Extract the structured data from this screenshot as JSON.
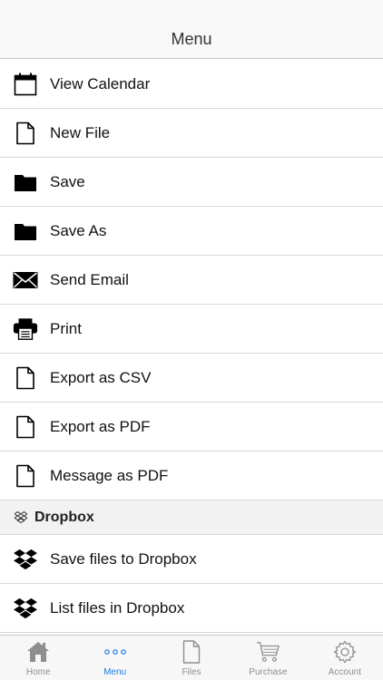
{
  "navbar": {
    "title": "Menu"
  },
  "menu_items": [
    {
      "label": "View Calendar",
      "icon": "calendar-icon"
    },
    {
      "label": "New File",
      "icon": "file-icon"
    },
    {
      "label": "Save",
      "icon": "folder-icon"
    },
    {
      "label": "Save As",
      "icon": "folder-icon"
    },
    {
      "label": "Send Email",
      "icon": "envelope-icon"
    },
    {
      "label": "Print",
      "icon": "printer-icon"
    },
    {
      "label": "Export as CSV",
      "icon": "file-icon"
    },
    {
      "label": "Export as PDF",
      "icon": "file-icon"
    },
    {
      "label": "Message as PDF",
      "icon": "file-icon"
    }
  ],
  "dropbox_section": {
    "title": "Dropbox",
    "icon": "dropbox-icon",
    "items": [
      {
        "label": "Save files to Dropbox",
        "icon": "dropbox-icon"
      },
      {
        "label": "List files in Dropbox",
        "icon": "dropbox-icon"
      }
    ]
  },
  "tabbar": {
    "active": "Menu",
    "tabs": [
      {
        "label": "Home",
        "icon": "home-icon"
      },
      {
        "label": "Menu",
        "icon": "more-dots-icon"
      },
      {
        "label": "Files",
        "icon": "file-icon"
      },
      {
        "label": "Purchase",
        "icon": "cart-icon"
      },
      {
        "label": "Account",
        "icon": "gear-icon"
      }
    ]
  },
  "colors": {
    "accent": "#1a7ae0",
    "tab_inactive": "#8e8e8e"
  }
}
